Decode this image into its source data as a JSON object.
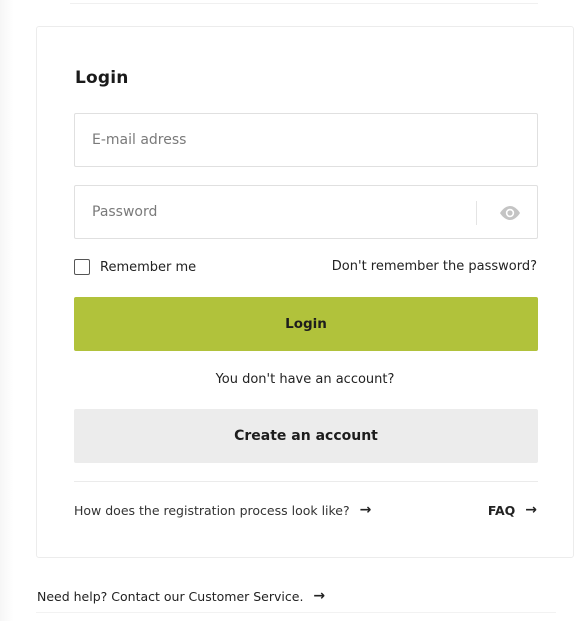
{
  "login": {
    "title": "Login",
    "email_placeholder": "E-mail adress",
    "password_placeholder": "Password",
    "remember_label": "Remember me",
    "forgot_label": "Don't remember the password?",
    "login_button": "Login",
    "no_account_text": "You don't have an account?",
    "create_button": "Create an account",
    "registration_link": "How does the registration process look like?",
    "faq_link": "FAQ",
    "arrow": "→"
  },
  "footer": {
    "help_text": "Need help? Contact our Customer Service.",
    "arrow": "→"
  },
  "colors": {
    "primary_button": "#b1c23b",
    "secondary_button": "#ececec",
    "border": "#e0e0e0",
    "text": "#222222"
  },
  "icons": {
    "password_toggle": "eye-icon"
  }
}
